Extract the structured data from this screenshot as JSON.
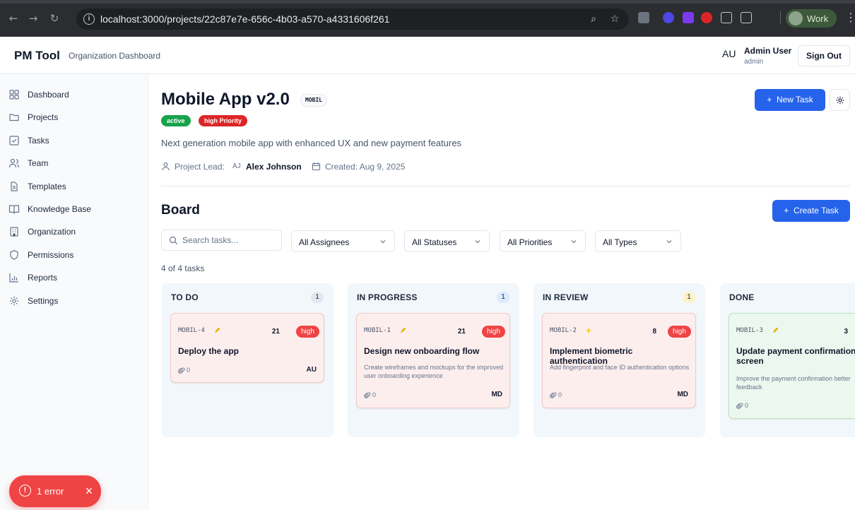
{
  "browser": {
    "url": "localhost:3000/projects/22c87e7e-656c-4b03-a570-a4331606f261",
    "profile_label": "Work"
  },
  "header": {
    "brand": "PM Tool",
    "subtitle": "Organization Dashboard",
    "user_initials": "AU",
    "user_name": "Admin User",
    "user_role": "admin",
    "sign_out_label": "Sign Out"
  },
  "sidebar": {
    "items": [
      {
        "label": "Dashboard",
        "icon": "grid-icon"
      },
      {
        "label": "Projects",
        "icon": "folder-icon"
      },
      {
        "label": "Tasks",
        "icon": "check-square-icon"
      },
      {
        "label": "Team",
        "icon": "users-icon"
      },
      {
        "label": "Templates",
        "icon": "file-text-icon"
      },
      {
        "label": "Knowledge Base",
        "icon": "book-icon"
      },
      {
        "label": "Organization",
        "icon": "building-icon"
      },
      {
        "label": "Permissions",
        "icon": "shield-icon"
      },
      {
        "label": "Reports",
        "icon": "bar-chart-icon"
      },
      {
        "label": "Settings",
        "icon": "gear-icon"
      }
    ]
  },
  "error_toast": {
    "label": "1 error",
    "color": "#ef4444"
  },
  "project": {
    "title": "Mobile App v2.0",
    "key": "MOBIL",
    "status": "active",
    "priority": "high Priority",
    "description": "Next generation mobile app with enhanced UX and new payment features",
    "lead_label": "Project Lead:",
    "lead_initials": "AJ",
    "lead_name": "Alex Johnson",
    "created": "Created: Aug 9, 2025",
    "new_task_label": "New Task"
  },
  "board": {
    "title": "Board",
    "create_task_label": "Create Task",
    "search_placeholder": "Search tasks...",
    "filters": [
      "All Assignees",
      "All Statuses",
      "All Priorities",
      "All Types"
    ],
    "task_count": "4 of 4 tasks",
    "columns": [
      {
        "title": "TO DO",
        "count": "1",
        "count_color": "#e2e8f0",
        "card": {
          "key": "MOBIL-4",
          "emoji": "pencil-icon",
          "points": "21",
          "priority": "high",
          "title": "Deploy the app",
          "description": "",
          "attachments": "0",
          "assignee": "AU"
        }
      },
      {
        "title": "IN PROGRESS",
        "count": "1",
        "count_color": "#dbeafe",
        "card": {
          "key": "MOBIL-1",
          "emoji": "pencil-icon",
          "points": "21",
          "priority": "high",
          "title": "Design new onboarding flow",
          "description": "Create wireframes and mockups for the improved user onboarding experience",
          "attachments": "0",
          "assignee": "MD"
        }
      },
      {
        "title": "IN REVIEW",
        "count": "1",
        "count_color": "#fef3c7",
        "card": {
          "key": "MOBIL-2",
          "emoji": "sparkle-icon",
          "points": "8",
          "priority": "high",
          "title": "Implement biometric authentication",
          "description": "Add fingerprint and face ID authentication options",
          "attachments": "0",
          "assignee": "MD"
        }
      },
      {
        "title": "DONE",
        "count": "",
        "count_color": "#dcfce7",
        "card": {
          "key": "MOBIL-3",
          "emoji": "pencil-icon",
          "points": "3",
          "priority": "",
          "title": "Update payment confirmation screen",
          "description": "Improve the payment confirmation better feedback",
          "attachments": "0",
          "assignee": ""
        }
      }
    ]
  }
}
